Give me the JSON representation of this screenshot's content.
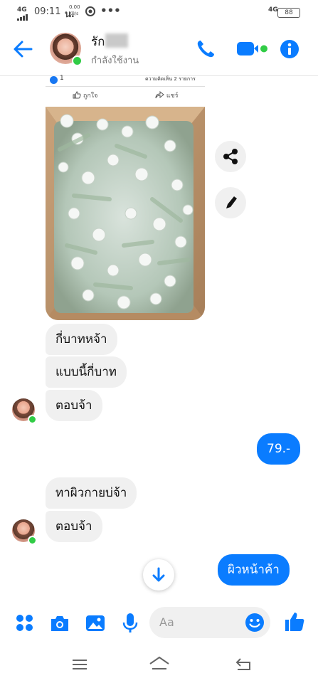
{
  "status_bar": {
    "network": "4G",
    "time": "09:11",
    "time_suffix": "น.",
    "data_rate": "0.00",
    "data_rate_unit": "KB/s",
    "right_network": "4G",
    "battery": "88"
  },
  "header": {
    "contact_name": "รัก",
    "contact_status": "กำลังใช้งาน"
  },
  "shared_post": {
    "like_count": "1",
    "comment_summary": "ความคิดเห็น 2 รายการ",
    "like_label": "ถูกใจ",
    "share_label": "แชร์"
  },
  "messages": [
    {
      "from": "contact",
      "text": "กี่บาทหจ้า"
    },
    {
      "from": "contact",
      "text": "แบบนี้กี่บาท"
    },
    {
      "from": "contact",
      "text": "ตอบจ้า"
    },
    {
      "from": "me",
      "text": "79.-"
    },
    {
      "from": "contact",
      "text": "ทาผิวกายบ่จ้า"
    },
    {
      "from": "contact",
      "text": "ตอบจ้า"
    },
    {
      "from": "me",
      "text": "ผิวหน้าค้า"
    }
  ],
  "composer": {
    "placeholder": "Aa"
  },
  "colors": {
    "accent": "#0a7cff",
    "online": "#31cc46",
    "bubble_in": "#f0f0f0"
  },
  "icons": [
    "back-arrow-icon",
    "phone-icon",
    "video-icon",
    "info-icon",
    "share-icon",
    "edit-icon",
    "scroll-down-icon",
    "apps-icon",
    "camera-icon",
    "image-icon",
    "mic-icon",
    "emoji-icon",
    "thumbs-up-icon"
  ]
}
